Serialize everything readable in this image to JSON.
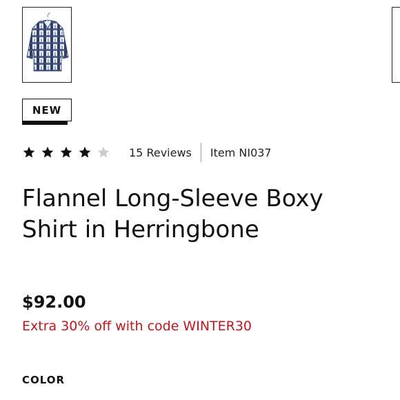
{
  "thumbnails": [
    {
      "icon": "flannel-shirt-thumbnail",
      "selected": true
    },
    {
      "icon": "next-thumbnail-partial",
      "selected": false
    }
  ],
  "badge": {
    "label": "NEW"
  },
  "rating": {
    "stars": 4,
    "max_stars": 5,
    "reviews_label": "15 Reviews",
    "item_label": "Item NI037",
    "star_color": "#111111",
    "empty_star_color": "#cccccc"
  },
  "product": {
    "title_line1": "Flannel Long-Sleeve Boxy",
    "title_line2": "Shirt in Herringbone",
    "price": "$92.00",
    "promo": "Extra 30% off with code WINTER30",
    "promo_color": "#c0151d"
  },
  "options": {
    "color_label": "COLOR"
  }
}
